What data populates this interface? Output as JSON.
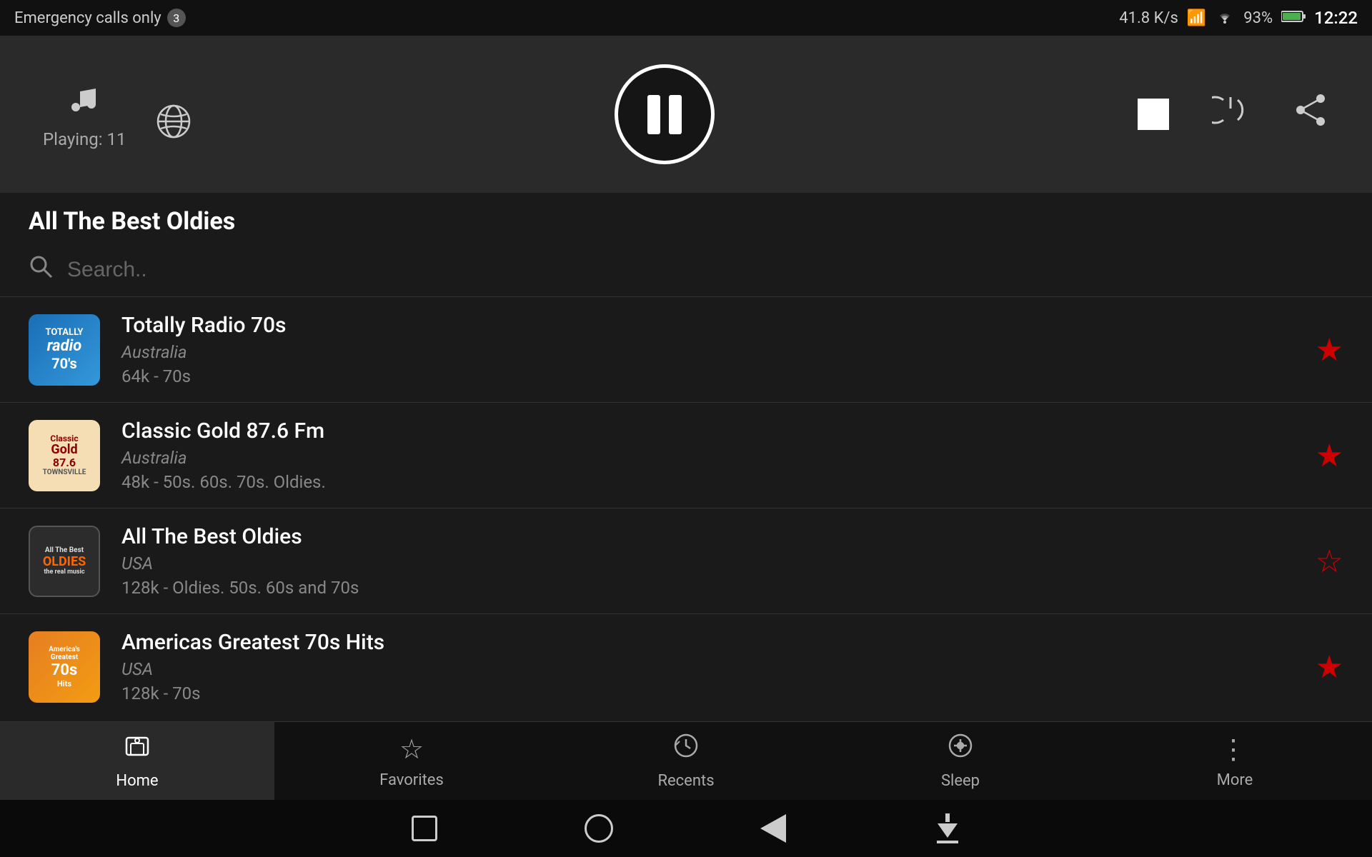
{
  "statusBar": {
    "emergencyText": "Emergency calls only",
    "badge": "3",
    "speed": "41.8 K/s",
    "time": "12:22",
    "battery": "93%"
  },
  "player": {
    "playingLabel": "Playing: 11",
    "pauseTitle": "Pause",
    "stopTitle": "Stop",
    "powerTitle": "Power",
    "shareTitle": "Share"
  },
  "currentStation": "All The Best Oldies",
  "search": {
    "placeholder": "Search.."
  },
  "stations": [
    {
      "id": 1,
      "name": "Totally Radio 70s",
      "country": "Australia",
      "details": "64k - 70s",
      "favorited": true,
      "logoType": "70s"
    },
    {
      "id": 2,
      "name": "Classic Gold 87.6 Fm",
      "country": "Australia",
      "details": "48k - 50s. 60s. 70s. Oldies.",
      "favorited": true,
      "logoType": "classic-gold"
    },
    {
      "id": 3,
      "name": "All The Best Oldies",
      "country": "USA",
      "details": "128k - Oldies. 50s. 60s and 70s",
      "favorited": false,
      "logoType": "oldies"
    },
    {
      "id": 4,
      "name": "Americas Greatest 70s Hits",
      "country": "USA",
      "details": "128k - 70s",
      "favorited": true,
      "logoType": "americas"
    }
  ],
  "bottomNav": {
    "items": [
      {
        "id": "home",
        "label": "Home",
        "icon": "home-icon",
        "active": true
      },
      {
        "id": "favorites",
        "label": "Favorites",
        "icon": "star-icon",
        "active": false
      },
      {
        "id": "recents",
        "label": "Recents",
        "icon": "recents-icon",
        "active": false
      },
      {
        "id": "sleep",
        "label": "Sleep",
        "icon": "sleep-icon",
        "active": false
      },
      {
        "id": "more",
        "label": "More",
        "icon": "more-icon",
        "active": false
      }
    ]
  }
}
